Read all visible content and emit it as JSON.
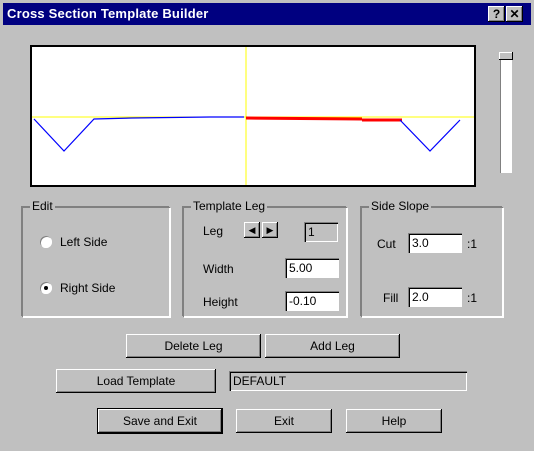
{
  "window": {
    "title": "Cross Section Template Builder",
    "help_glyph": "?",
    "close_glyph": "✕"
  },
  "edit_group": {
    "legend": "Edit",
    "left_side_label": "Left Side",
    "right_side_label": "Right Side",
    "selected": "Right Side"
  },
  "template_leg": {
    "legend": "Template Leg",
    "leg_label": "Leg",
    "leg_value": "1",
    "width_label": "Width",
    "width_value": "5.00",
    "height_label": "Height",
    "height_value": "-0.10"
  },
  "side_slope": {
    "legend": "Side Slope",
    "cut_label": "Cut",
    "cut_value": "3.0",
    "cut_suffix": ":1",
    "fill_label": "Fill",
    "fill_value": "2.0",
    "fill_suffix": ":1"
  },
  "buttons": {
    "delete_leg": "Delete Leg",
    "add_leg": "Add Leg",
    "load_template": "Load Template",
    "save_exit": "Save and Exit",
    "exit": "Exit",
    "help": "Help"
  },
  "template_name": "DEFAULT",
  "colors": {
    "title_bar": "#000080",
    "axis": "#ffff00",
    "left_profile": "#0000ff",
    "right_profile_active": "#ff0000",
    "right_slope": "#0000ff"
  }
}
